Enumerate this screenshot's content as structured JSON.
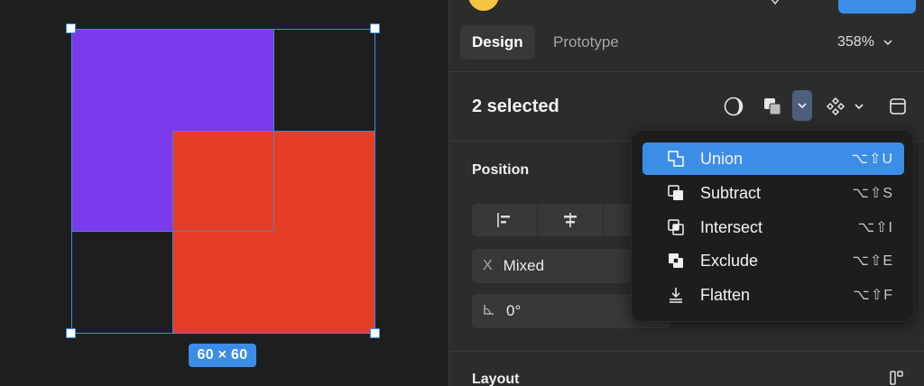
{
  "canvas": {
    "size_badge": "60 × 60",
    "colors": {
      "purple": "#7b3aeb",
      "red": "#e63e26",
      "selection": "#3d8ef0"
    }
  },
  "header": {
    "tabs": [
      {
        "label": "Design"
      },
      {
        "label": "Prototype"
      }
    ],
    "zoom": "358%"
  },
  "selection": {
    "title": "2 selected"
  },
  "position": {
    "title": "Position",
    "x_label": "X",
    "x_value": "Mixed",
    "rotation_value": "0°"
  },
  "layout": {
    "title": "Layout"
  },
  "boolean_menu": {
    "items": [
      {
        "label": "Union",
        "shortcut": "⌥⇧U",
        "icon": "union-icon"
      },
      {
        "label": "Subtract",
        "shortcut": "⌥⇧S",
        "icon": "subtract-icon"
      },
      {
        "label": "Intersect",
        "shortcut": "⌥⇧I",
        "icon": "intersect-icon"
      },
      {
        "label": "Exclude",
        "shortcut": "⌥⇧E",
        "icon": "exclude-icon"
      },
      {
        "label": "Flatten",
        "shortcut": "⌥⇧F",
        "icon": "flatten-icon"
      }
    ],
    "active_color": "#3c8de8"
  }
}
